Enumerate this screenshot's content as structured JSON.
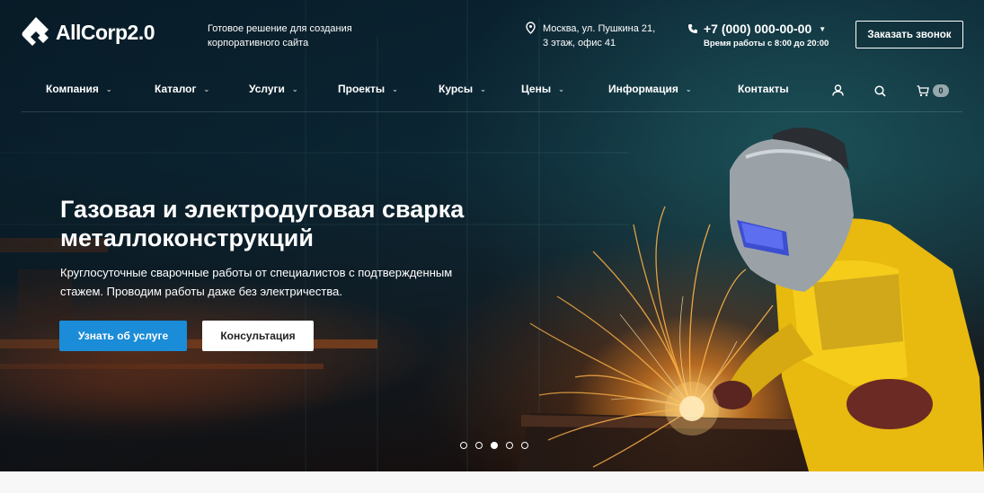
{
  "header": {
    "logo_text": "AllCorp2.0",
    "tagline": "Готовое решение для создания корпоративного сайта",
    "address_line1": "Москва, ул. Пушкина 21,",
    "address_line2": "3 этаж, офис 41",
    "phone": "+7 (000) 000-00-00",
    "hours": "Время работы с 8:00 до 20:00",
    "callback_label": "Заказать звонок"
  },
  "nav": {
    "items": [
      {
        "label": "Компания",
        "has_dropdown": true
      },
      {
        "label": "Каталог",
        "has_dropdown": true
      },
      {
        "label": "Услуги",
        "has_dropdown": true
      },
      {
        "label": "Проекты",
        "has_dropdown": true
      },
      {
        "label": "Курсы",
        "has_dropdown": true
      },
      {
        "label": "Цены",
        "has_dropdown": true
      },
      {
        "label": "Информация",
        "has_dropdown": true
      },
      {
        "label": "Контакты",
        "has_dropdown": false
      }
    ],
    "cart_count": "0",
    "icons": [
      "user-icon",
      "search-icon",
      "cart-icon"
    ]
  },
  "hero": {
    "title": "Газовая и электродуговая сварка металлоконструкций",
    "subtitle": "Круглосуточные сварочные работы от специалистов с подтвержденным стажем. Проводим работы даже без электричества.",
    "primary_button": "Узнать об услуге",
    "secondary_button": "Консультация",
    "slides_total": 5,
    "active_slide": 3
  },
  "colors": {
    "accent": "#1a8cd8",
    "header_text": "#ffffff"
  }
}
